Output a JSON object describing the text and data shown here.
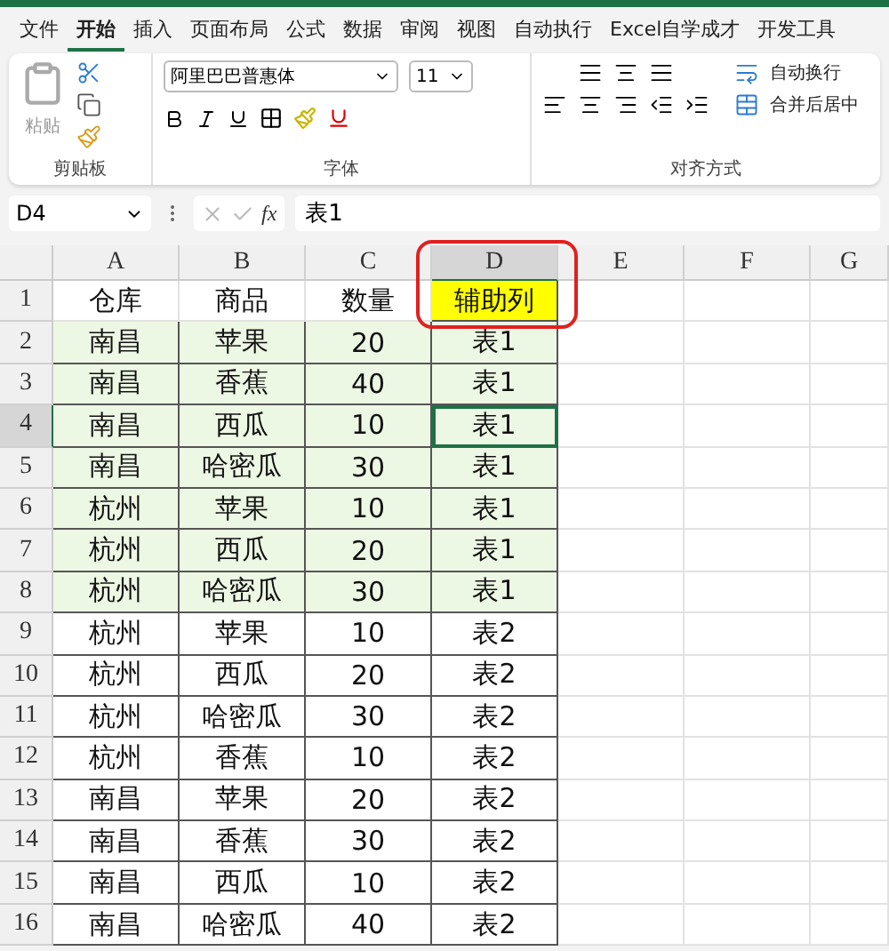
{
  "menu_tabs": [
    {
      "label": "文件",
      "selected": false
    },
    {
      "label": "开始",
      "selected": true
    },
    {
      "label": "插入",
      "selected": false
    },
    {
      "label": "页面布局",
      "selected": false
    },
    {
      "label": "公式",
      "selected": false
    },
    {
      "label": "数据",
      "selected": false
    },
    {
      "label": "审阅",
      "selected": false
    },
    {
      "label": "视图",
      "selected": false
    },
    {
      "label": "自动执行",
      "selected": false
    },
    {
      "label": "Excel自学成才",
      "selected": false
    },
    {
      "label": "开发工具",
      "selected": false
    }
  ],
  "ribbon": {
    "clipboard": {
      "paste": "粘贴",
      "group": "剪贴板"
    },
    "font": {
      "name": "阿里巴巴普惠体",
      "size": "11",
      "group": "字体"
    },
    "alignment": {
      "wrap": "自动换行",
      "merge": "合并后居中",
      "group": "对齐方式"
    }
  },
  "formula_bar": {
    "cell_ref": "D4",
    "formula": "表1",
    "function_label": "fx"
  },
  "sheet": {
    "columns": [
      {
        "label": "A",
        "selected": false,
        "annotated": false
      },
      {
        "label": "B",
        "selected": false,
        "annotated": false
      },
      {
        "label": "C",
        "selected": false,
        "annotated": false
      },
      {
        "label": "D",
        "selected": true,
        "annotated": true
      },
      {
        "label": "E",
        "selected": false,
        "annotated": false
      },
      {
        "label": "F",
        "selected": false,
        "annotated": false
      },
      {
        "label": "G",
        "selected": false,
        "annotated": false
      }
    ],
    "rows": [
      {
        "number": "1",
        "kind": "header",
        "selected": false,
        "highlighted": false,
        "cells": [
          "仓库",
          "商品",
          "数量",
          "辅助列"
        ]
      },
      {
        "number": "2",
        "kind": "data",
        "selected": false,
        "highlighted": true,
        "cells": [
          "南昌",
          "苹果",
          "20",
          "表1"
        ]
      },
      {
        "number": "3",
        "kind": "data",
        "selected": false,
        "highlighted": true,
        "cells": [
          "南昌",
          "香蕉",
          "40",
          "表1"
        ]
      },
      {
        "number": "4",
        "kind": "data",
        "selected": true,
        "highlighted": true,
        "cells": [
          "南昌",
          "西瓜",
          "10",
          "表1"
        ]
      },
      {
        "number": "5",
        "kind": "data",
        "selected": false,
        "highlighted": true,
        "cells": [
          "南昌",
          "哈密瓜",
          "30",
          "表1"
        ]
      },
      {
        "number": "6",
        "kind": "data",
        "selected": false,
        "highlighted": true,
        "cells": [
          "杭州",
          "苹果",
          "10",
          "表1"
        ]
      },
      {
        "number": "7",
        "kind": "data",
        "selected": false,
        "highlighted": true,
        "cells": [
          "杭州",
          "西瓜",
          "20",
          "表1"
        ]
      },
      {
        "number": "8",
        "kind": "data",
        "selected": false,
        "highlighted": true,
        "cells": [
          "杭州",
          "哈密瓜",
          "30",
          "表1"
        ]
      },
      {
        "number": "9",
        "kind": "data",
        "selected": false,
        "highlighted": false,
        "cells": [
          "杭州",
          "苹果",
          "10",
          "表2"
        ]
      },
      {
        "number": "10",
        "kind": "data",
        "selected": false,
        "highlighted": false,
        "cells": [
          "杭州",
          "西瓜",
          "20",
          "表2"
        ]
      },
      {
        "number": "11",
        "kind": "data",
        "selected": false,
        "highlighted": false,
        "cells": [
          "杭州",
          "哈密瓜",
          "30",
          "表2"
        ]
      },
      {
        "number": "12",
        "kind": "data",
        "selected": false,
        "highlighted": false,
        "cells": [
          "杭州",
          "香蕉",
          "10",
          "表2"
        ]
      },
      {
        "number": "13",
        "kind": "data",
        "selected": false,
        "highlighted": false,
        "cells": [
          "南昌",
          "苹果",
          "20",
          "表2"
        ]
      },
      {
        "number": "14",
        "kind": "data",
        "selected": false,
        "highlighted": false,
        "cells": [
          "南昌",
          "香蕉",
          "30",
          "表2"
        ]
      },
      {
        "number": "15",
        "kind": "data",
        "selected": false,
        "highlighted": false,
        "cells": [
          "南昌",
          "西瓜",
          "10",
          "表2"
        ]
      },
      {
        "number": "16",
        "kind": "data",
        "selected": false,
        "highlighted": false,
        "cells": [
          "南昌",
          "哈密瓜",
          "40",
          "表2"
        ]
      }
    ]
  }
}
